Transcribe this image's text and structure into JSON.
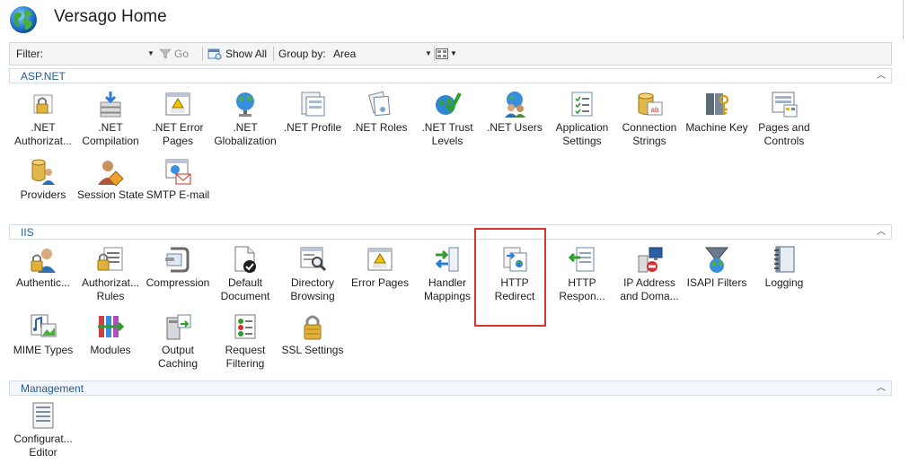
{
  "header": {
    "title": "Versago Home"
  },
  "toolbar": {
    "filter_label": "Filter:",
    "go_label": "Go",
    "show_all_label": "Show All",
    "group_by_label": "Group by:",
    "group_by_value": "Area"
  },
  "sections": {
    "aspnet": {
      "title": "ASP.NET",
      "items": [
        {
          "label": ".NET\nAuthorizat..."
        },
        {
          "label": ".NET\nCompilation"
        },
        {
          "label": ".NET Error\nPages"
        },
        {
          "label": ".NET\nGlobalization"
        },
        {
          "label": ".NET Profile"
        },
        {
          "label": ".NET Roles"
        },
        {
          "label": ".NET Trust\nLevels"
        },
        {
          "label": ".NET Users"
        },
        {
          "label": "Application\nSettings"
        },
        {
          "label": "Connection\nStrings"
        },
        {
          "label": "Machine Key"
        },
        {
          "label": "Pages and\nControls"
        },
        {
          "label": "Providers"
        },
        {
          "label": "Session State"
        },
        {
          "label": "SMTP E-mail"
        }
      ]
    },
    "iis": {
      "title": "IIS",
      "items": [
        {
          "label": "Authentic..."
        },
        {
          "label": "Authorizat...\nRules"
        },
        {
          "label": "Compression"
        },
        {
          "label": "Default\nDocument"
        },
        {
          "label": "Directory\nBrowsing"
        },
        {
          "label": "Error Pages"
        },
        {
          "label": "Handler\nMappings"
        },
        {
          "label": "HTTP\nRedirect"
        },
        {
          "label": "HTTP\nRespon..."
        },
        {
          "label": "IP Address\nand Doma..."
        },
        {
          "label": "ISAPI Filters"
        },
        {
          "label": "Logging"
        },
        {
          "label": "MIME Types"
        },
        {
          "label": "Modules"
        },
        {
          "label": "Output\nCaching"
        },
        {
          "label": "Request\nFiltering"
        },
        {
          "label": "SSL Settings"
        }
      ]
    },
    "management": {
      "title": "Management",
      "items": [
        {
          "label": "Configurat...\nEditor"
        }
      ]
    }
  },
  "icons": {
    "globe": "globe-icon",
    "go": "funnel-icon",
    "show_all": "show-all-icon",
    "view": "view-grid-icon"
  },
  "colors": {
    "section_title": "#1f5b9c",
    "highlight": "#d9312b"
  }
}
